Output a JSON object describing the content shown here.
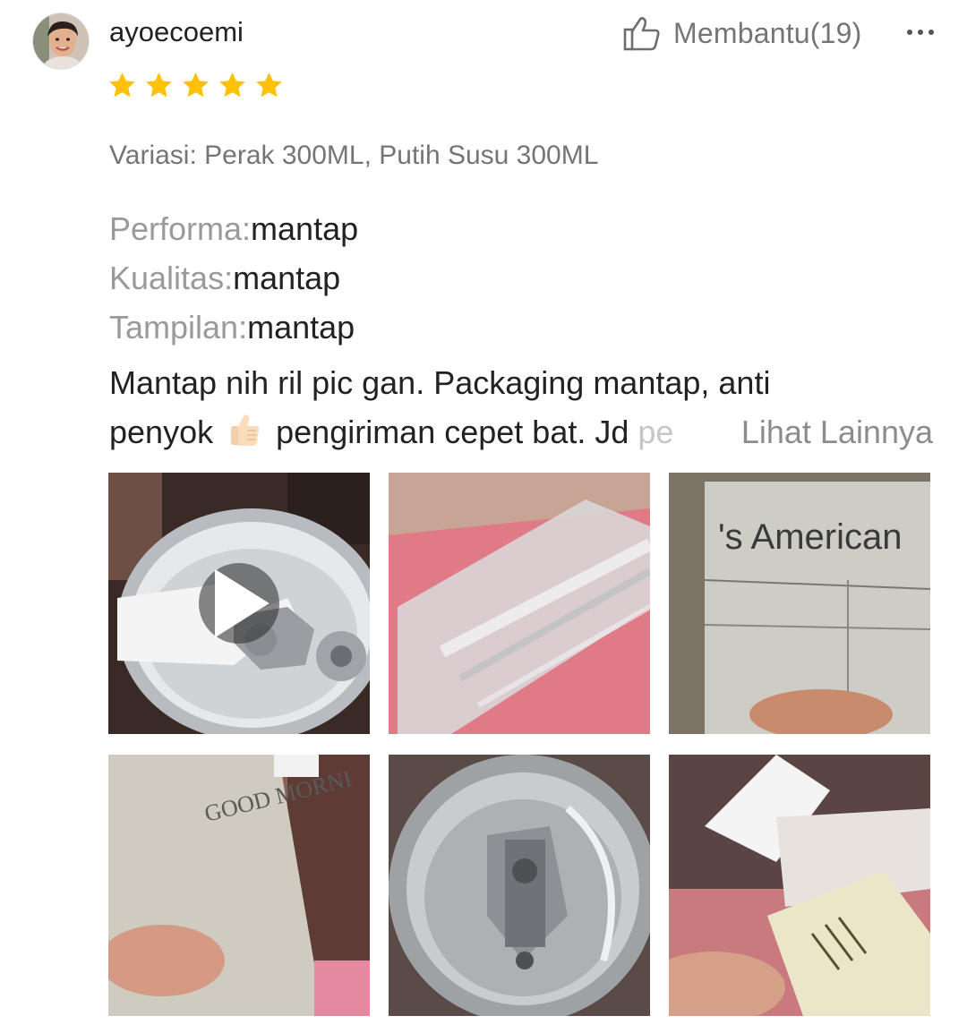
{
  "review": {
    "username": "ayoecoemi",
    "helpful_label": "Membantu(19)",
    "rating": 5,
    "variation": "Variasi: Perak 300ML, Putih Susu 300ML",
    "attributes": [
      {
        "key": "Performa:",
        "value": "mantap"
      },
      {
        "key": "Kualitas:",
        "value": "mantap"
      },
      {
        "key": "Tampilan:",
        "value": "mantap"
      }
    ],
    "comment": {
      "line1": "Mantap nih ril pic gan. Packaging mantap, anti",
      "line2_before_emoji": "penyok",
      "line2_after_emoji": "pengiriman cepet bat. Jd ",
      "line2_faded": "pe",
      "see_more": "Lihat Lainnya"
    },
    "media_overlay_texts": {
      "photo3": "'s American",
      "photo4": "GOOD MORNI"
    }
  },
  "colors": {
    "star": "#FFC107",
    "muted_text": "#757575",
    "label_text": "#9a9a9a",
    "primary_text": "#222222"
  }
}
